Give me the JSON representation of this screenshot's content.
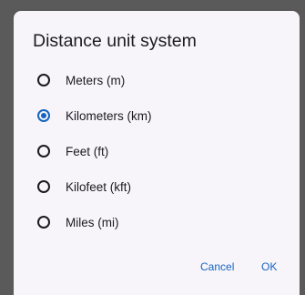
{
  "dialog": {
    "title": "Distance unit system",
    "options": [
      {
        "label": "Meters (m)",
        "selected": false
      },
      {
        "label": "Kilometers (km)",
        "selected": true
      },
      {
        "label": "Feet (ft)",
        "selected": false
      },
      {
        "label": "Kilofeet (kft)",
        "selected": false
      },
      {
        "label": "Miles (mi)",
        "selected": false
      }
    ],
    "cancel_label": "Cancel",
    "ok_label": "OK"
  },
  "colors": {
    "accent": "#1565c0",
    "surface": "#f7f4fa",
    "scrim": "#5a5a5a",
    "text": "#1c1b1f"
  },
  "icons": {
    "radio_selected": "radio-checked-icon",
    "radio_unselected": "radio-unchecked-icon"
  }
}
